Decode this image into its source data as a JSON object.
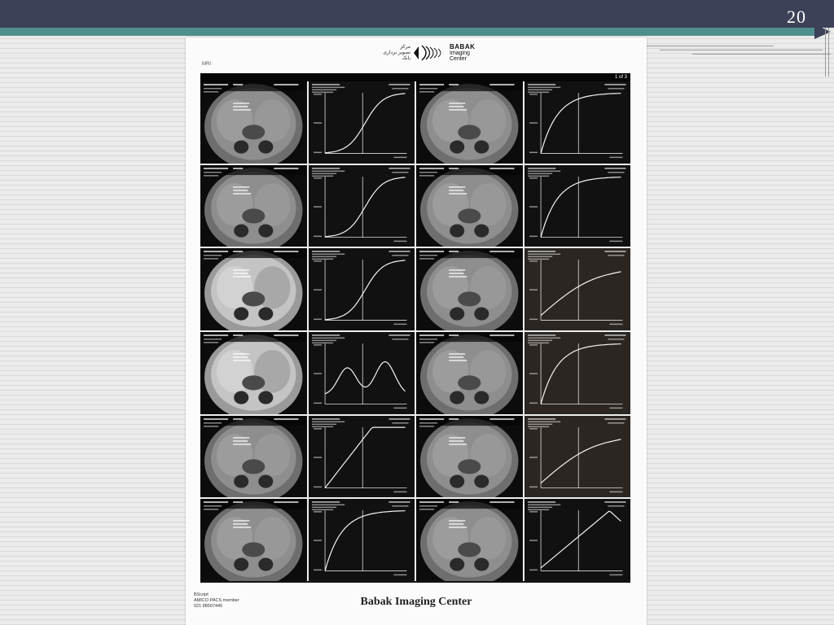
{
  "slide": {
    "number": "20"
  },
  "document": {
    "header_small": "MRI",
    "logo": {
      "farsi_lines": [
        "مرکز",
        "تصویر برداری",
        "بابک"
      ],
      "name": "BABAK",
      "line2": "Imaging",
      "line3": "Center"
    },
    "page_indicator": "1 of 3",
    "footer_left": [
      "BScript",
      "AMICO PACS member",
      "021 88507445"
    ],
    "footer_center": "Babak Imaging Center"
  },
  "film": {
    "rows": [
      {
        "curve_left": "sigmoid",
        "curve_right": "saturating",
        "mri_left": "mri",
        "mri_right": "mri"
      },
      {
        "curve_left": "sigmoid",
        "curve_right": "saturating",
        "mri_left": "mri",
        "mri_right": "mri"
      },
      {
        "curve_left": "sigmoid",
        "curve_right": "linear",
        "mri_left": "mri-bright",
        "mri_right": "mri"
      },
      {
        "curve_left": "double-hump",
        "curve_right": "saturating",
        "mri_left": "mri-bright",
        "mri_right": "mri"
      },
      {
        "curve_left": "plateau",
        "curve_right": "linear",
        "mri_left": "mri",
        "mri_right": "mri"
      },
      {
        "curve_left": "saturating",
        "curve_right": "late-peak",
        "mri_left": "mri",
        "mri_right": "mri"
      }
    ]
  }
}
